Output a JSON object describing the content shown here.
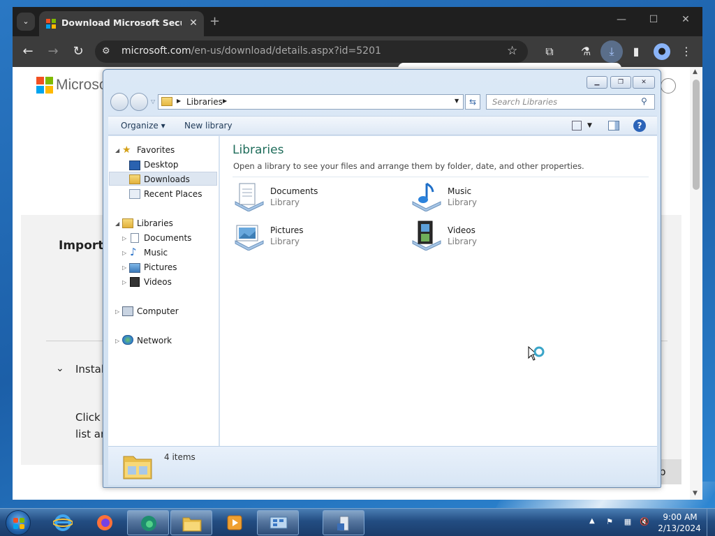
{
  "browser": {
    "tab_title": "Download Microsoft Security E",
    "tab_close": "✕",
    "new_tab": "+",
    "url_host": "microsoft.com",
    "url_path": "/en-us/download/details.aspx?id=5201",
    "tab_list": "⌄",
    "minimize": "—",
    "maximize": "☐",
    "close": "✕"
  },
  "page": {
    "logo_text": "Microso",
    "important_text": "Importa",
    "section_text": "Instal",
    "click_line1": "Click t",
    "click_line2": "list an",
    "button_text": "p"
  },
  "explorer": {
    "address_crumb": "Libraries",
    "search_placeholder": "Search Libraries",
    "toolbar": {
      "organize_label": "Organize",
      "new_library_label": "New library"
    },
    "nav": {
      "favorites": "Favorites",
      "desktop": "Desktop",
      "downloads": "Downloads",
      "recent_places": "Recent Places",
      "libraries": "Libraries",
      "documents": "Documents",
      "music": "Music",
      "pictures": "Pictures",
      "videos": "Videos",
      "computer": "Computer",
      "network": "Network"
    },
    "content": {
      "title": "Libraries",
      "description": "Open a library to see your files and arrange them by folder, date, and other properties.",
      "items": [
        {
          "name": "Documents",
          "type": "Library"
        },
        {
          "name": "Music",
          "type": "Library"
        },
        {
          "name": "Pictures",
          "type": "Library"
        },
        {
          "name": "Videos",
          "type": "Library"
        }
      ]
    },
    "status": {
      "item_count": "4 items"
    }
  },
  "taskbar": {
    "time": "9:00 AM",
    "date": "2/13/2024",
    "tray_arrow": "▲"
  },
  "colors": {
    "library_title": "#1e6c5a",
    "chrome_dark": "#1f1f1f",
    "taskbar_blue": "#234d82"
  },
  "icons": {
    "ms_squares": [
      "#f25022",
      "#7fba00",
      "#00a4ef",
      "#ffb900"
    ]
  }
}
